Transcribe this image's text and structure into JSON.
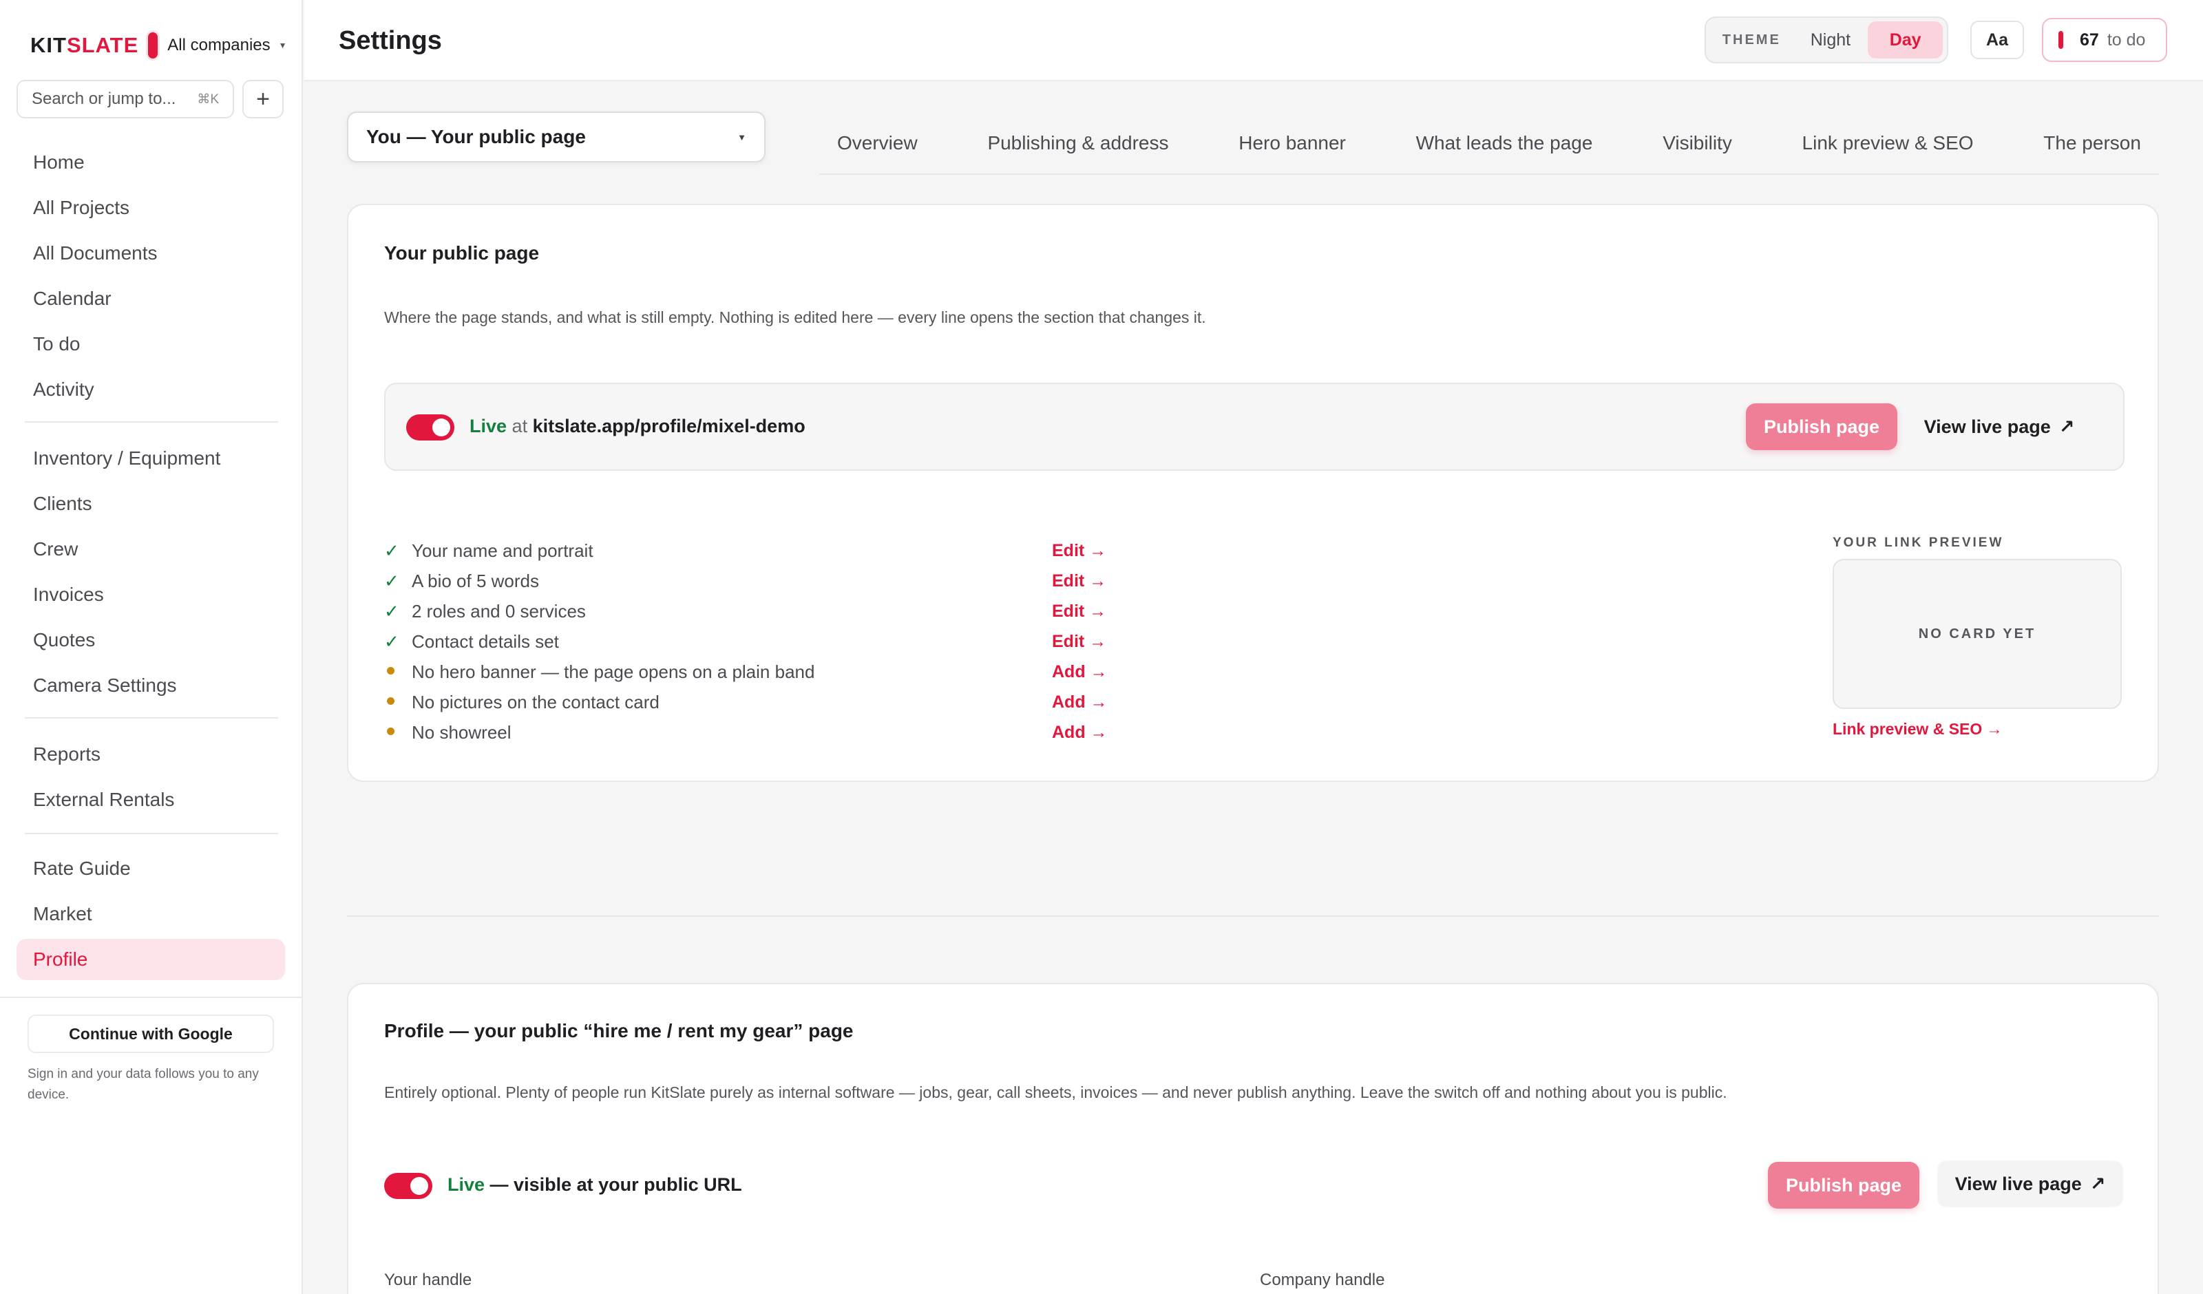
{
  "sidebar": {
    "brand": {
      "name_plain": "KIT",
      "name_accent": "SLATE",
      "company": "All companies"
    },
    "search": {
      "placeholder": "Search or jump to...",
      "shortcut": "⌘K"
    },
    "add_label": "+",
    "groups": [
      {
        "items": [
          {
            "label": "Home"
          },
          {
            "label": "All Projects"
          },
          {
            "label": "All Documents"
          },
          {
            "label": "Calendar"
          },
          {
            "label": "To do"
          },
          {
            "label": "Activity"
          }
        ]
      },
      {
        "items": [
          {
            "label": "Inventory / Equipment"
          },
          {
            "label": "Clients"
          },
          {
            "label": "Crew"
          },
          {
            "label": "Invoices"
          },
          {
            "label": "Quotes"
          },
          {
            "label": "Camera Settings"
          }
        ]
      },
      {
        "items": [
          {
            "label": "Reports"
          },
          {
            "label": "External Rentals"
          }
        ]
      },
      {
        "items": [
          {
            "label": "Rate Guide"
          },
          {
            "label": "Market"
          },
          {
            "label": "Profile",
            "active": true
          }
        ]
      }
    ],
    "google_button": "Continue with Google",
    "signin_note": "Sign in and your data follows you to any device."
  },
  "topbar": {
    "title": "Settings",
    "theme": {
      "label": "THEME",
      "options": [
        "Night",
        "Day"
      ],
      "selected": "Day"
    },
    "font_button": "Aa",
    "todo": {
      "count": "67",
      "label": "to do"
    }
  },
  "subnav": {
    "section_select": "You — Your public page",
    "tabs": [
      "Overview",
      "Publishing & address",
      "Hero banner",
      "What leads the page",
      "Visibility",
      "Link preview & SEO",
      "The person"
    ]
  },
  "card1": {
    "title": "Your public page",
    "description": "Where the page stands, and what is still empty. Nothing is edited here — every line opens the section that changes it.",
    "live": {
      "status": "Live",
      "at": "at",
      "url": "kitslate.app/profile/mixel-demo",
      "enabled": true
    },
    "publish_button": "Publish page",
    "view_button": "View live page",
    "view_icon": "↗",
    "checklist": [
      {
        "state": "done",
        "text": "Your name and portrait",
        "action": "Edit →"
      },
      {
        "state": "done",
        "text": "A bio of 5 words",
        "action": "Edit →"
      },
      {
        "state": "done",
        "text": "2 roles and 0 services",
        "action": "Edit →"
      },
      {
        "state": "done",
        "text": "Contact details set",
        "action": "Edit →"
      },
      {
        "state": "todo",
        "text": "No hero banner — the page opens on a plain band",
        "action": "Add →"
      },
      {
        "state": "todo",
        "text": "No pictures on the contact card",
        "action": "Add →"
      },
      {
        "state": "todo",
        "text": "No showreel",
        "action": "Add →"
      }
    ],
    "link_preview": {
      "label": "YOUR LINK PREVIEW",
      "empty": "NO CARD YET",
      "link": "Link preview & SEO →"
    }
  },
  "card2": {
    "title": "Profile — your public “hire me / rent my gear” page",
    "description": "Entirely optional. Plenty of people run KitSlate purely as internal software — jobs, gear, call sheets, invoices — and never publish anything. Leave the switch off and nothing about you is public.",
    "live": {
      "status": "Live",
      "rest": "— visible at your public URL",
      "enabled": true
    },
    "publish_button": "Publish page",
    "view_button": "View live page",
    "view_icon": "↗",
    "fields": {
      "handle": "Your handle",
      "company_handle": "Company handle"
    }
  },
  "colors": {
    "accent": "#e2173d",
    "success": "#15803d",
    "warning": "#c98a0a",
    "publish": "#ee7f97"
  }
}
